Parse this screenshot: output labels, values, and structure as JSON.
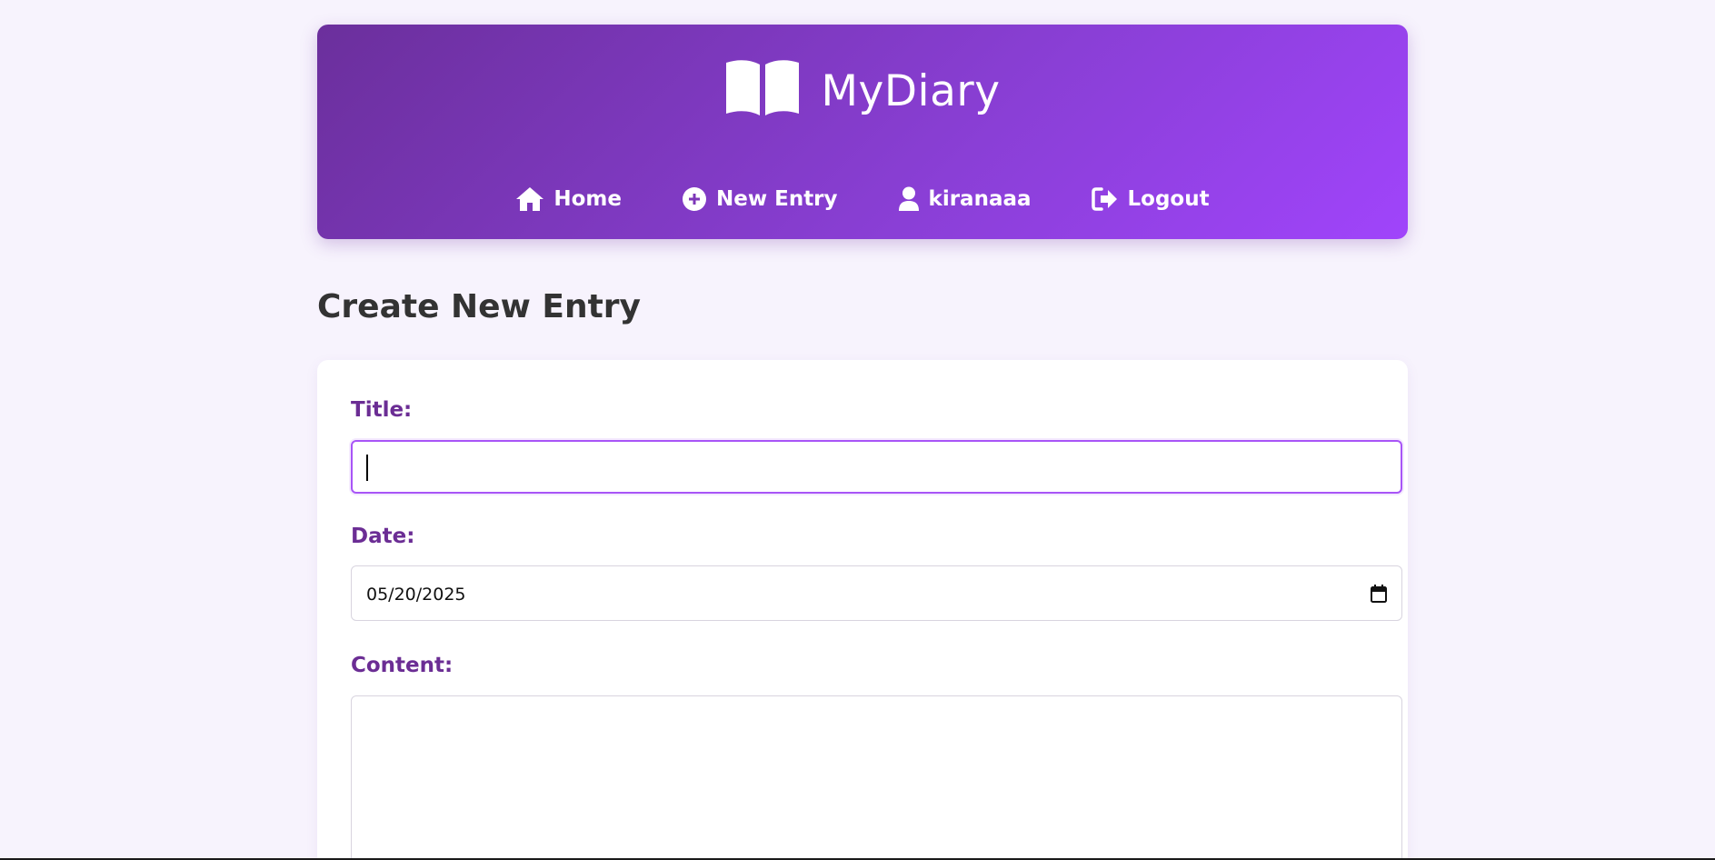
{
  "header": {
    "brand_title": "MyDiary",
    "brand_icon": "open-book-icon",
    "nav": [
      {
        "label": "Home",
        "icon": "home-icon"
      },
      {
        "label": "New Entry",
        "icon": "plus-circle-icon"
      },
      {
        "label": "kiranaaa",
        "icon": "user-icon"
      },
      {
        "label": "Logout",
        "icon": "logout-icon"
      }
    ]
  },
  "page": {
    "heading": "Create New Entry"
  },
  "form": {
    "title": {
      "label": "Title:",
      "value": ""
    },
    "date": {
      "label": "Date:",
      "value": "05/20/2025",
      "icon": "calendar-icon"
    },
    "content": {
      "label": "Content:",
      "value": ""
    }
  },
  "colors": {
    "header_gradient_start": "#6b2f9c",
    "header_gradient_end": "#a044fb",
    "label_color": "#6b2d94",
    "focus_border": "#a855f7",
    "page_background": "#f7f3fd"
  }
}
